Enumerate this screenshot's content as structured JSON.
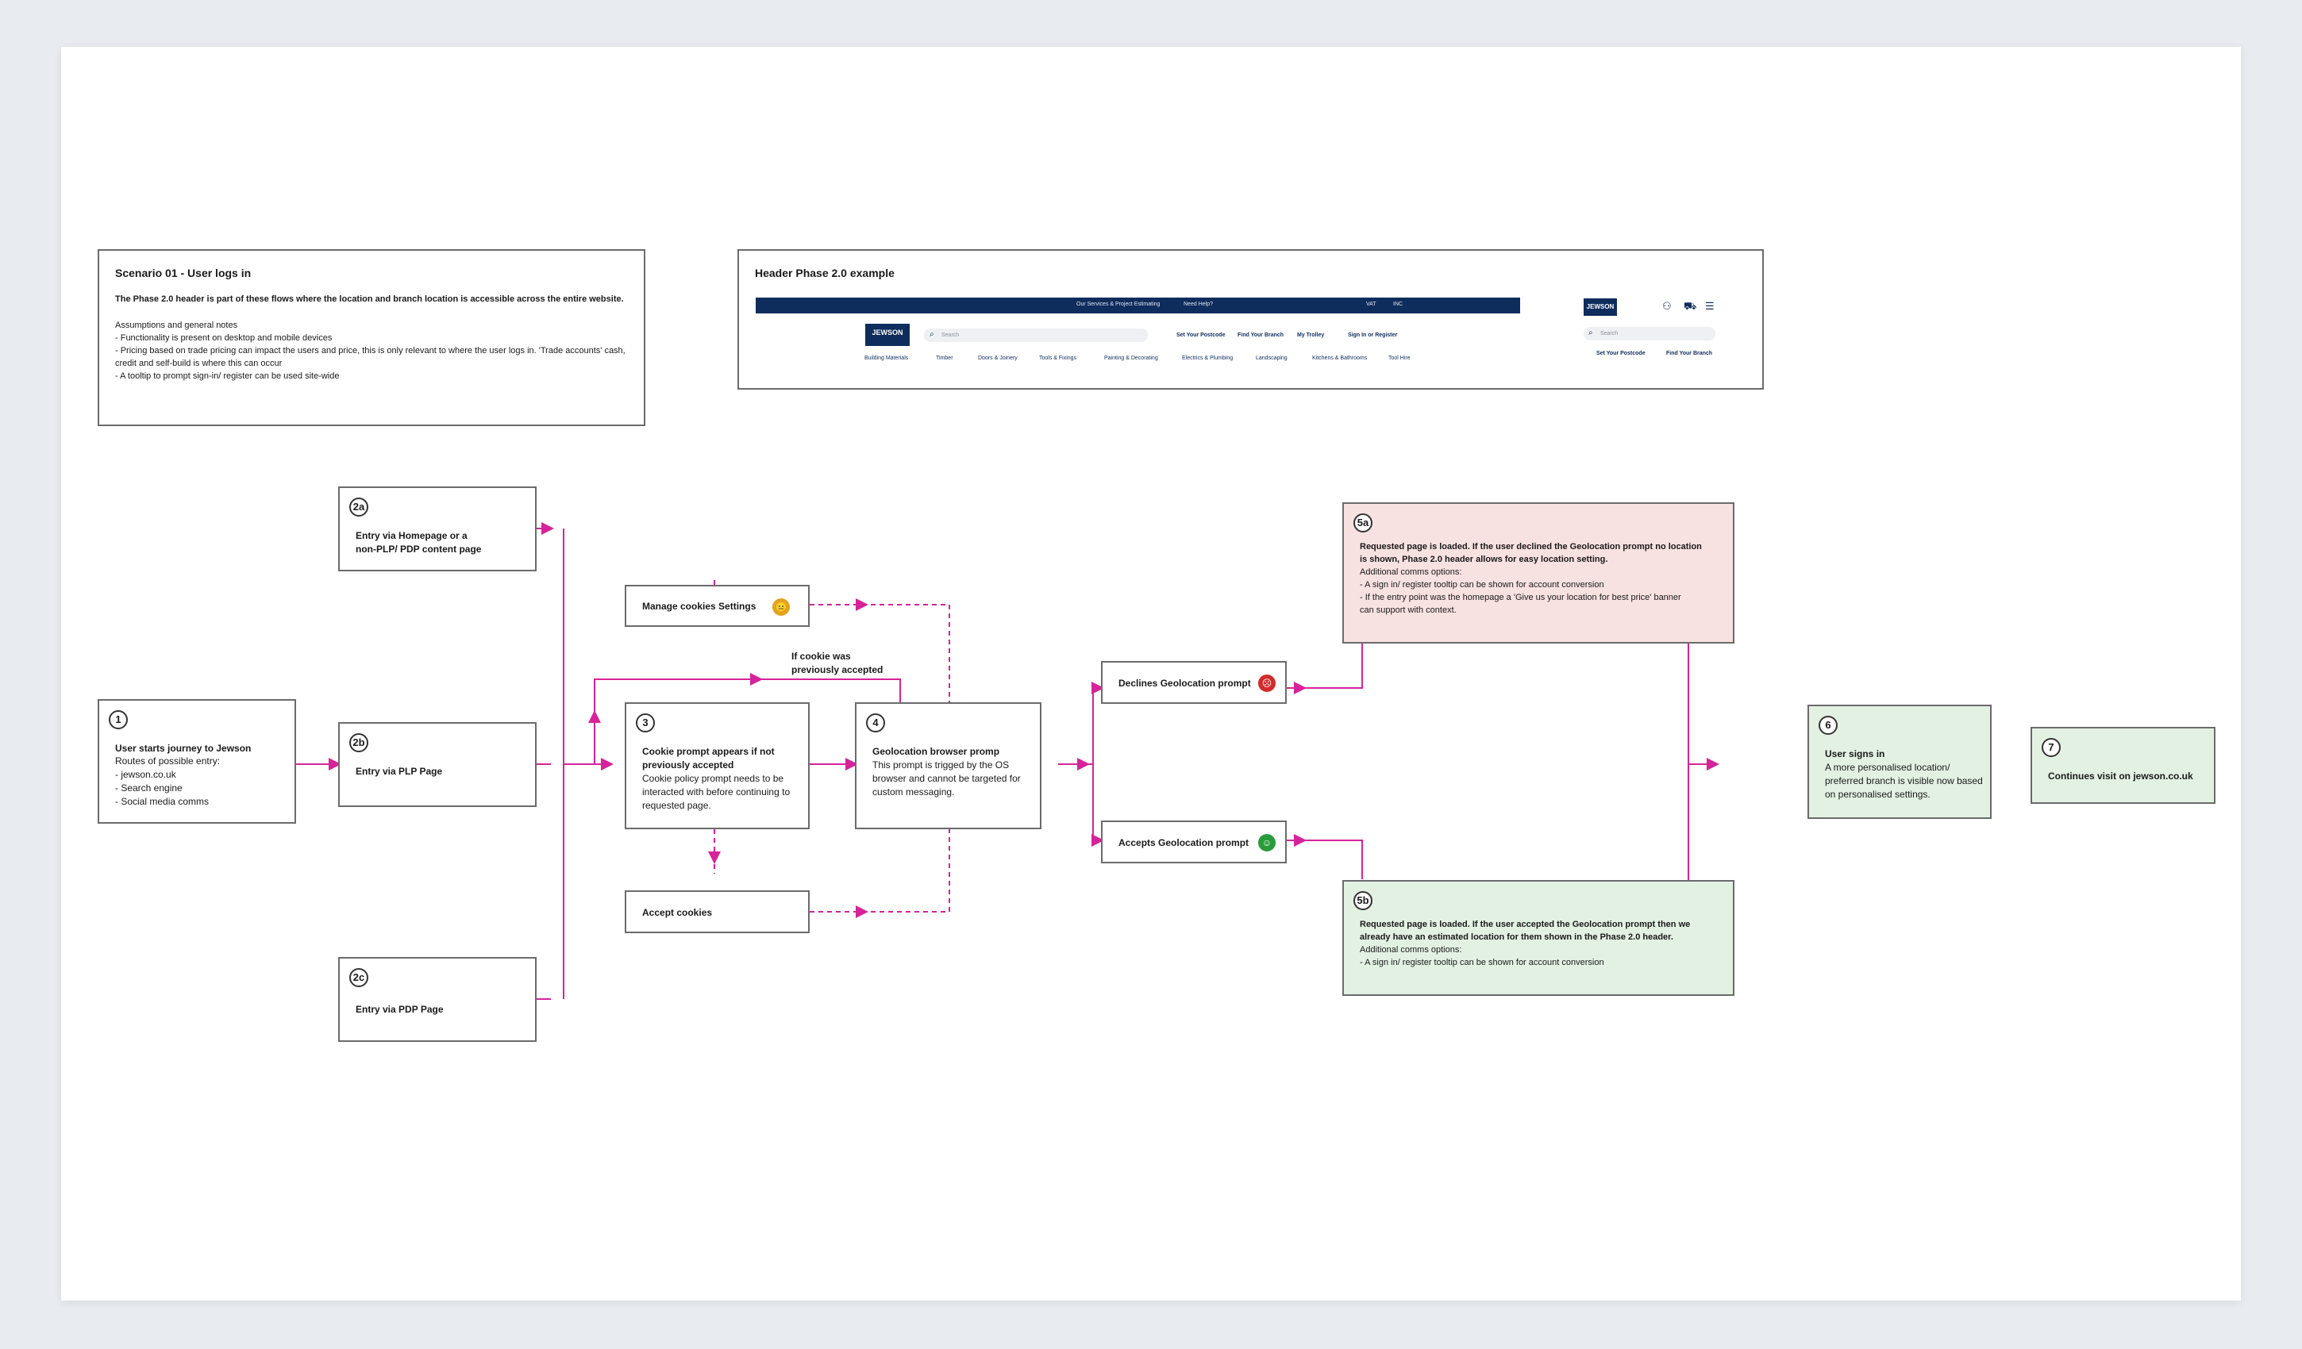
{
  "scenario": {
    "title": "Scenario 01 - User logs in",
    "intro": "The Phase 2.0 header is part of these flows where the location and branch location is accessible across the entire website.",
    "notes": "Assumptions and general notes\n- Functionality is present on desktop and mobile devices\n- Pricing based on trade pricing can impact the users and price, this is only relevant to where the user logs in. 'Trade accounts' cash, credit and self-build is where this can occur\n- A tooltip to prompt sign-in/ register can be used site-wide"
  },
  "header_example": {
    "title": "Header Phase 2.0 example",
    "top_links": [
      "Our Services & Project Estimating",
      "Need Help?",
      "VAT",
      "INC"
    ],
    "logo": "JEWSON",
    "search_placeholder": "Search",
    "actions": [
      "Set Your Postcode",
      "Find Your Branch",
      "My Trolley",
      "Sign In or Register"
    ],
    "categories": [
      "Building Materials",
      "Timber",
      "Doors & Joinery",
      "Tools & Fixings",
      "Painting & Decorating",
      "Electrics & Plumbing",
      "Landscaping",
      "Kitchens & Bathrooms",
      "Tool Hire"
    ],
    "mobile": {
      "logo": "JEWSON",
      "search_placeholder": "Search",
      "actions": [
        "Set Your Postcode",
        "Find Your Branch"
      ]
    }
  },
  "nodes": {
    "n1": {
      "badge": "1",
      "title": "User starts journey to Jewson",
      "body": "Routes of possible entry:\n- jewson.co.uk\n- Search engine\n- Social media comms"
    },
    "n2a": {
      "badge": "2a",
      "title": "Entry via Homepage or a\nnon-PLP/ PDP content page"
    },
    "n2b": {
      "badge": "2b",
      "title": "Entry via PLP Page"
    },
    "n2c": {
      "badge": "2c",
      "title": "Entry via PDP Page"
    },
    "manage": {
      "title": "Manage cookies Settings"
    },
    "n3": {
      "badge": "3",
      "title": "Cookie prompt appears if not\npreviously accepted",
      "body": "Cookie policy prompt needs to be\ninteracted with before continuing to\nrequested page."
    },
    "accept": {
      "title": "Accept cookies"
    },
    "n4": {
      "badge": "4",
      "title": "Geolocation browser promp",
      "body": "This prompt is trigged by the OS\nbrowser and cannot be targeted for\ncustom messaging."
    },
    "cookie_note": "If cookie was\npreviously accepted",
    "declines": {
      "title": "Declines Geolocation prompt"
    },
    "accepts": {
      "title": "Accepts Geolocation prompt"
    },
    "n5a": {
      "badge": "5a",
      "title": "Requested page is loaded. If the user declined the Geolocation prompt no location\nis shown, Phase 2.0 header allows for easy location setting.",
      "body": "Additional comms options:\n- A sign in/ register tooltip can be shown for account conversion\n- If the entry point was the homepage a 'Give us your location for best price' banner\ncan support with context."
    },
    "n5b": {
      "badge": "5b",
      "title": "Requested page is loaded. If the user accepted the Geolocation prompt then we\nalready have an estimated location for them shown in the Phase 2.0 header.",
      "body": "Additional comms options:\n- A sign in/ register tooltip can be shown for account conversion"
    },
    "n6": {
      "badge": "6",
      "title": "User signs in",
      "body": "A more personalised location/\npreferred branch is visible now based\non personalised settings."
    },
    "n7": {
      "badge": "7",
      "title": "Continues visit on jewson.co.uk"
    }
  },
  "colors": {
    "connector": "#d6239a",
    "navy": "#0f2d5c",
    "decline_bg": "#f8e1e1",
    "accept_bg": "#e3f1e2"
  },
  "icons": {
    "manage": "neutral-face-icon",
    "declines": "angry-face-icon",
    "accepts": "smile-face-icon"
  }
}
